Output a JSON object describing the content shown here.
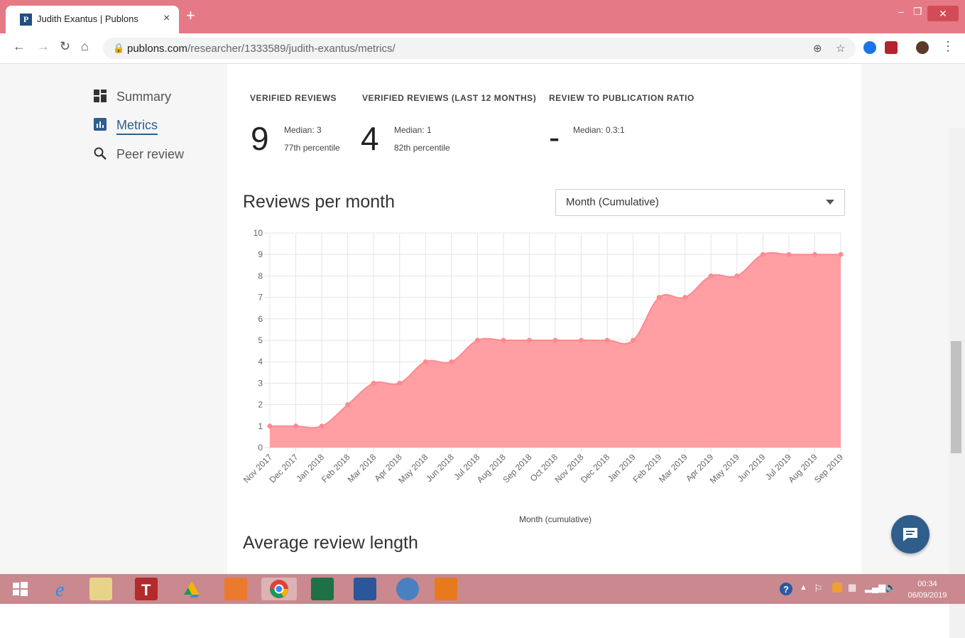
{
  "browser": {
    "tab_title": "Judith Exantus | Publons",
    "tab_favicon_letter": "P",
    "url_domain": "publons.com",
    "url_path": "/researcher/1333589/judith-exantus/metrics/",
    "new_tab_symbol": "+",
    "close_tab_symbol": "×"
  },
  "sidebar": {
    "items": [
      {
        "label": "Summary",
        "icon": "dashboard-icon"
      },
      {
        "label": "Metrics",
        "icon": "bar-chart-icon",
        "active": true
      },
      {
        "label": "Peer review",
        "icon": "search-icon"
      }
    ]
  },
  "stats": [
    {
      "heading": "VERIFIED REVIEWS",
      "value": "9",
      "line1": "Median: 3",
      "line2": "77th percentile"
    },
    {
      "heading": "VERIFIED REVIEWS (LAST 12 MONTHS)",
      "value": "4",
      "line1": "Median: 1",
      "line2": "82th percentile"
    },
    {
      "heading": "REVIEW TO PUBLICATION RATIO",
      "value": "-",
      "line1": "Median: 0.3:1",
      "line2": ""
    }
  ],
  "reviews_section": {
    "title": "Reviews per month",
    "select_value": "Month (Cumulative)"
  },
  "next_section_title": "Average review length",
  "chart_data": {
    "type": "area",
    "title": "",
    "xlabel": "Month (cumulative)",
    "ylabel": "",
    "categories": [
      "Nov 2017",
      "Dec 2017",
      "Jan 2018",
      "Feb 2018",
      "Mar 2018",
      "Apr 2018",
      "May 2018",
      "Jun 2018",
      "Jul 2018",
      "Aug 2018",
      "Sep 2018",
      "Oct 2018",
      "Nov 2018",
      "Dec 2018",
      "Jan 2019",
      "Feb 2019",
      "Mar 2019",
      "Apr 2019",
      "May 2019",
      "Jun 2019",
      "Jul 2019",
      "Aug 2019",
      "Sep 2019"
    ],
    "values": [
      1,
      1,
      1,
      2,
      3,
      3,
      4,
      4,
      5,
      5,
      5,
      5,
      5,
      5,
      5,
      7,
      7,
      8,
      8,
      9,
      9,
      9,
      9
    ],
    "ylim": [
      0,
      10
    ],
    "yticks": [
      0,
      1,
      2,
      3,
      4,
      5,
      6,
      7,
      8,
      9,
      10
    ],
    "grid": true,
    "color": "#ff9fa3"
  },
  "taskbar": {
    "clock_time": "00:34",
    "clock_date": "06/09/2019"
  },
  "colors": {
    "accent": "#2f5d8c",
    "titlebar": "#e57a86",
    "taskbar": "#c9898e"
  }
}
